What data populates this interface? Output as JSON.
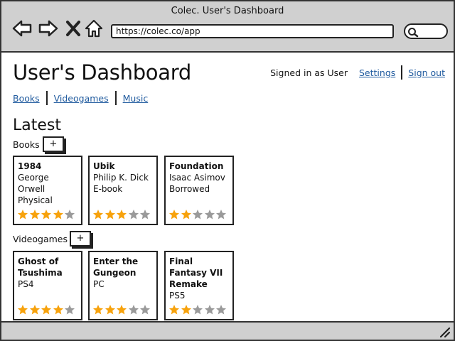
{
  "browser": {
    "title": "Colec. User's Dashboard",
    "url": "https://colec.co/app",
    "nav": [
      {
        "name": "back-icon"
      },
      {
        "name": "forward-icon"
      },
      {
        "name": "stop-icon"
      },
      {
        "name": "home-icon"
      }
    ],
    "search_icon": "search-icon"
  },
  "page": {
    "title": "User's Dashboard",
    "signed_in": "Signed in as User",
    "settings": "Settings",
    "sign_out": "Sign out",
    "tabs": [
      "Books",
      "Videogames",
      "Music"
    ],
    "latest": "Latest"
  },
  "sections": [
    {
      "label": "Books",
      "add": "+",
      "items": [
        {
          "title": "1984",
          "line1": "George Orwell",
          "line2": "Physical",
          "rating": 4
        },
        {
          "title": "Ubik",
          "line1": "Philip K. Dick",
          "line2": "E-book",
          "rating": 3
        },
        {
          "title": "Foundation",
          "line1": "Isaac Asimov",
          "line2": "Borrowed",
          "rating": 2
        }
      ]
    },
    {
      "label": "Videogames",
      "add": "+",
      "items": [
        {
          "title": "Ghost of Tsushima",
          "line1": "PS4",
          "rating": 4
        },
        {
          "title": "Enter the Gungeon",
          "line1": "PC",
          "rating": 3
        },
        {
          "title": "Final Fantasy VII Remake",
          "line1": "PS5",
          "rating": 2
        }
      ]
    }
  ],
  "colors": {
    "star_filled": "#f7a20c",
    "star_empty": "#9a9a9a",
    "link": "#1f5a9e"
  },
  "max_rating": 5
}
